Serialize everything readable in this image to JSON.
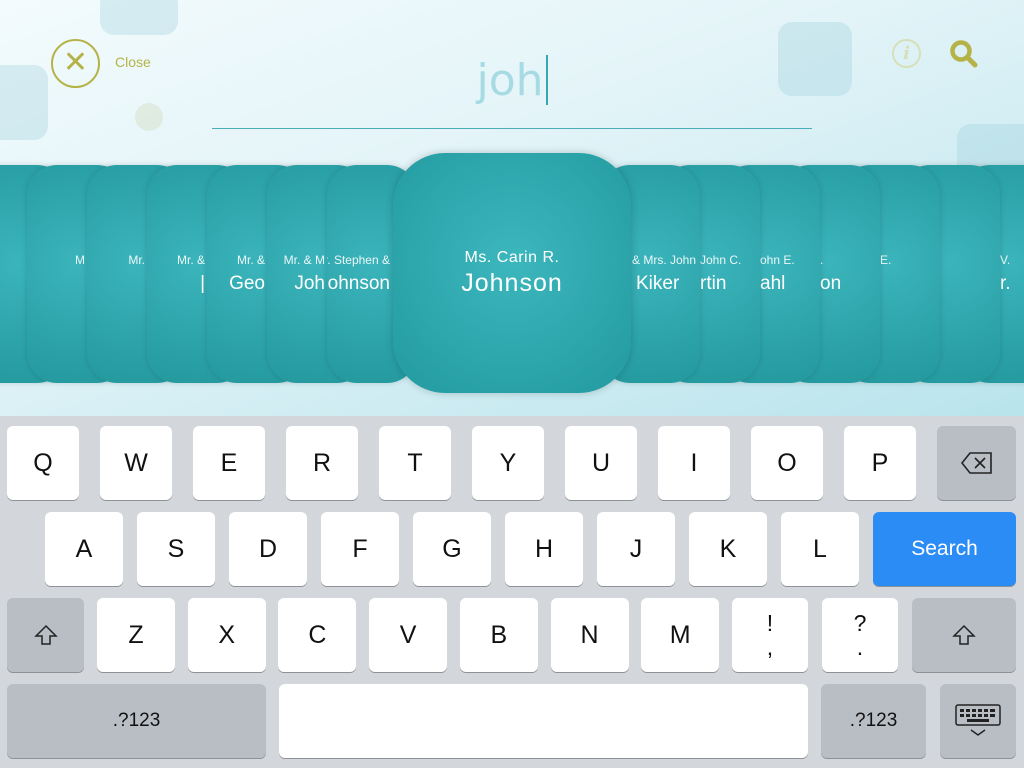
{
  "header": {
    "close_label": "Close",
    "close_icon": "x-circle-icon",
    "info_icon": "info-icon",
    "search_icon": "search-icon",
    "query": "joh"
  },
  "colors": {
    "accent": "#b5b347",
    "card": "#2aa4a9",
    "search_key": "#2c8cf5"
  },
  "cards_left": [
    {
      "l1": "",
      "l2": ""
    },
    {
      "l1": "M",
      "l2": ""
    },
    {
      "l1": "Mr.",
      "l2": ""
    },
    {
      "l1": "Mr. &",
      "l2": "|"
    },
    {
      "l1": "Mr. &",
      "l2": "Geo"
    },
    {
      "l1": "Mr. & M",
      "l2": "Joh"
    },
    {
      "l1": "Mr. Stephen &",
      "l2": "Johnson"
    }
  ],
  "selected": {
    "l1": "Ms. Carin R.",
    "l2": "Johnson"
  },
  "cards_right": [
    {
      "l1": "& Mrs. John H.",
      "l2": "Kiker"
    },
    {
      "l1": "John C.",
      "l2": "rtin"
    },
    {
      "l1": "ohn E.",
      "l2": "ahl"
    },
    {
      "l1": ".",
      "l2": "on"
    },
    {
      "l1": "E.",
      "l2": ""
    },
    {
      "l1": "",
      "l2": ""
    },
    {
      "l1": "V.",
      "l2": "r."
    }
  ],
  "keyboard": {
    "row1": [
      "Q",
      "W",
      "E",
      "R",
      "T",
      "Y",
      "U",
      "I",
      "O",
      "P"
    ],
    "row2": [
      "A",
      "S",
      "D",
      "F",
      "G",
      "H",
      "J",
      "K",
      "L"
    ],
    "row3": [
      "Z",
      "X",
      "C",
      "V",
      "B",
      "N",
      "M"
    ],
    "punct1": [
      "!",
      ","
    ],
    "punct2": [
      "?",
      "."
    ],
    "search": "Search",
    "numbers": ".?123",
    "backspace_icon": "backspace-icon",
    "shift_icon": "shift-icon",
    "hide_icon": "keyboard-hide-icon"
  }
}
